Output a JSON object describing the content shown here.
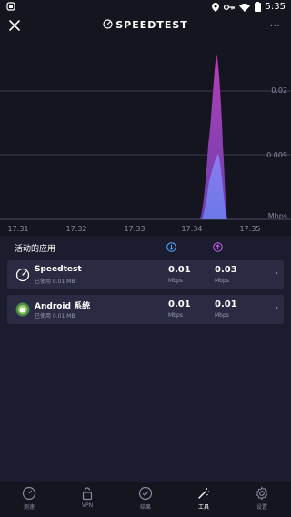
{
  "status": {
    "time": "5:35"
  },
  "topbar": {
    "title": "SPEEDTEST",
    "more": "···"
  },
  "chart_data": {
    "type": "area",
    "x": [
      "17:31",
      "17:32",
      "17:33",
      "17:34",
      "17:35"
    ],
    "ylabels": [
      "0.02",
      "0.009"
    ],
    "yunit": "Mbps",
    "series": [
      {
        "name": "upload",
        "color": "#a13bb0",
        "peak": 0.028
      },
      {
        "name": "download",
        "color": "#7a7ce8",
        "peak": 0.011
      }
    ]
  },
  "section": {
    "label": "活动的应用"
  },
  "apps": [
    {
      "name": "Speedtest",
      "used": "已使用 0.01 MB",
      "download": "0.01",
      "upload": "0.03",
      "unit": "Mbps"
    },
    {
      "name": "Android 系统",
      "used": "已使用 0.01 MB",
      "download": "0.01",
      "upload": "0.01",
      "unit": "Mbps"
    }
  ],
  "nav": [
    {
      "label": "测速",
      "icon": "gauge-icon"
    },
    {
      "label": "VPN",
      "icon": "lock-icon"
    },
    {
      "label": "结果",
      "icon": "check-circle-icon"
    },
    {
      "label": "工具",
      "icon": "wand-icon"
    },
    {
      "label": "设置",
      "icon": "gear-icon"
    }
  ]
}
